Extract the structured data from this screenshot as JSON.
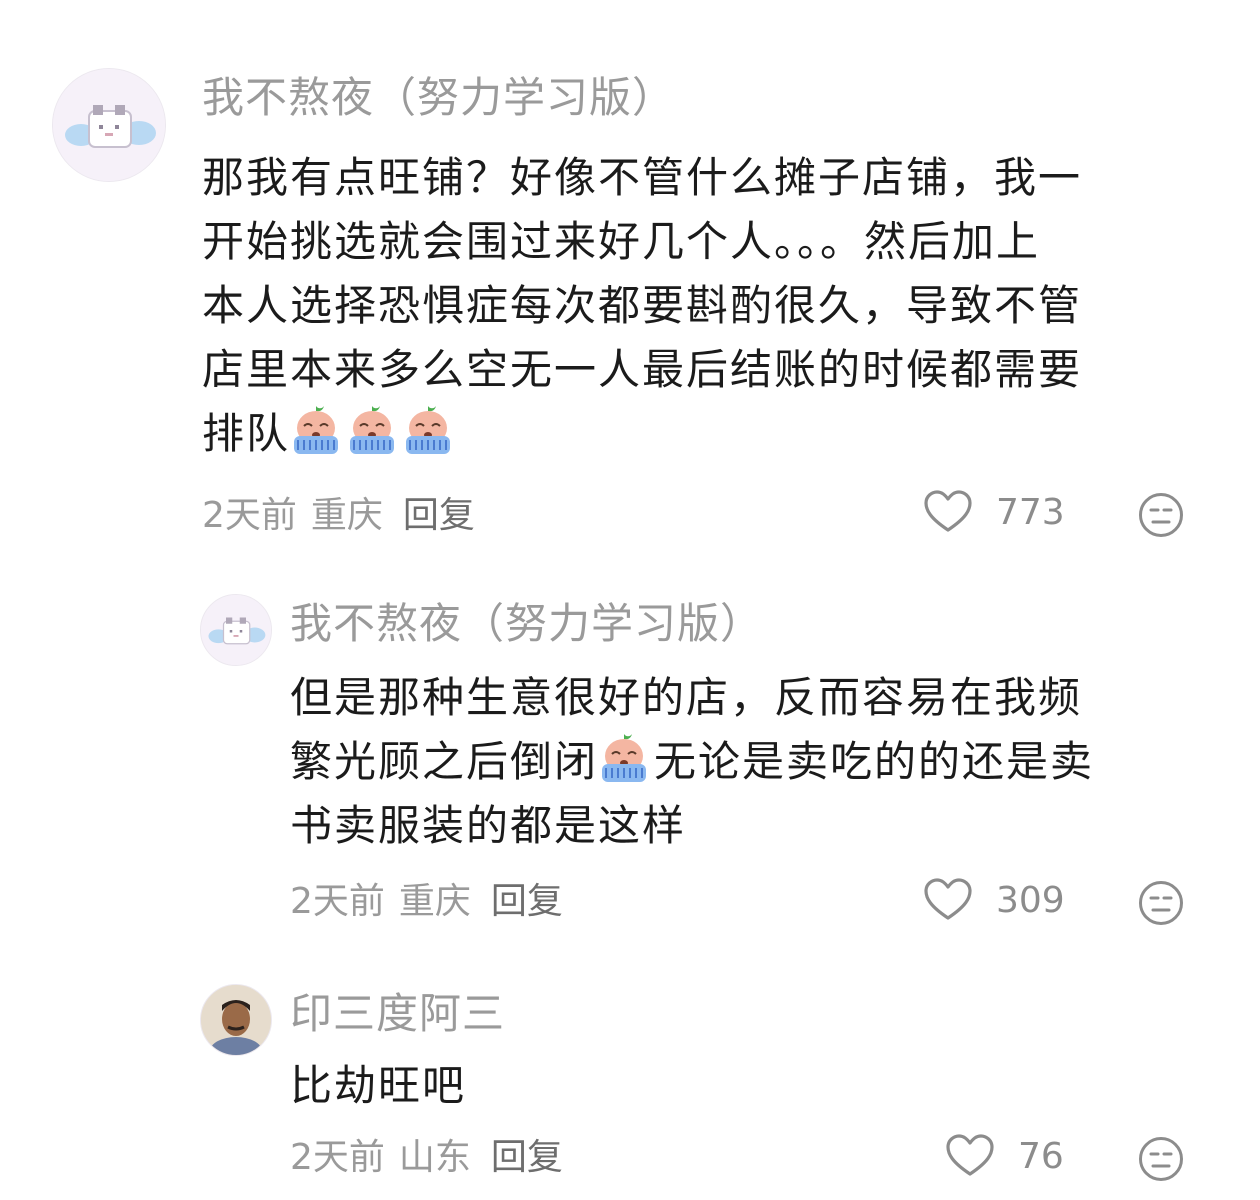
{
  "comments": [
    {
      "author": "我不熬夜（努力学习版）",
      "lines": [
        "那我有点旺铺？好像不管什么摊子店铺，我一",
        "开始挑选就会围过来好几个人。。。然后加上",
        "本人选择恐惧症每次都要斟酌很久，导致不管",
        "店里本来多么空无一人最后结账的时候都需要",
        "排队"
      ],
      "time": "2天前",
      "location": "重庆",
      "reply_label": "回复",
      "likes": "773"
    },
    {
      "author": "我不熬夜（努力学习版）",
      "lines": [
        "但是那种生意很好的店，反而容易在我频",
        "繁光顾之后倒闭",
        "无论是卖吃的的还是卖",
        "书卖服装的都是这样"
      ],
      "time": "2天前",
      "location": "重庆",
      "reply_label": "回复",
      "likes": "309"
    },
    {
      "author": "印三度阿三",
      "lines": [
        "比劫旺吧"
      ],
      "time": "2天前",
      "location": "山东",
      "reply_label": "回复",
      "likes": "76"
    }
  ],
  "icons": {
    "like": "heart-outline-icon",
    "react": "neutral-face-icon",
    "crying": "crying-emoji-icon"
  },
  "colors": {
    "name": "#9a9a9a",
    "text": "#1b1b1b",
    "meta": "#9a9a9a"
  }
}
